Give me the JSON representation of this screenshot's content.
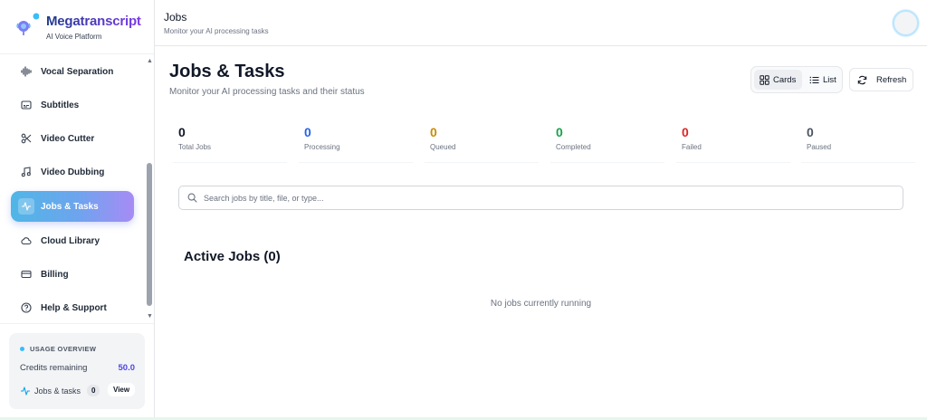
{
  "brand": {
    "name": "Megatranscript",
    "subtitle": "AI Voice Platform"
  },
  "sidebar": {
    "items": [
      {
        "label": "Vocal Separation",
        "icon": "waveform-icon",
        "active": false
      },
      {
        "label": "Subtitles",
        "icon": "subtitles-icon",
        "active": false
      },
      {
        "label": "Video Cutter",
        "icon": "scissors-icon",
        "active": false
      },
      {
        "label": "Video Dubbing",
        "icon": "music-note-icon",
        "active": false
      },
      {
        "label": "Jobs & Tasks",
        "icon": "activity-icon",
        "active": true
      },
      {
        "label": "Cloud Library",
        "icon": "cloud-icon",
        "active": false
      },
      {
        "label": "Billing",
        "icon": "credit-card-icon",
        "active": false
      },
      {
        "label": "Help & Support",
        "icon": "help-circle-icon",
        "active": false
      }
    ],
    "usage": {
      "title": "USAGE OVERVIEW",
      "credits_label": "Credits remaining",
      "credits_value": "50.0",
      "jobs_label": "Jobs & tasks",
      "jobs_count": "0",
      "view_label": "View"
    }
  },
  "header": {
    "title": "Jobs",
    "subtitle": "Monitor your AI processing tasks"
  },
  "main": {
    "title": "Jobs & Tasks",
    "subtitle": "Monitor your AI processing tasks and their status",
    "view_toggle": {
      "cards_label": "Cards",
      "list_label": "List",
      "selected": "Cards"
    },
    "refresh_label": "Refresh",
    "stats": [
      {
        "value": "0",
        "label": "Total Jobs",
        "color": "#111827"
      },
      {
        "value": "0",
        "label": "Processing",
        "color": "#2563eb"
      },
      {
        "value": "0",
        "label": "Queued",
        "color": "#ca8a04"
      },
      {
        "value": "0",
        "label": "Completed",
        "color": "#16a34a"
      },
      {
        "value": "0",
        "label": "Failed",
        "color": "#dc2626"
      },
      {
        "value": "0",
        "label": "Paused",
        "color": "#4b5563"
      }
    ],
    "search": {
      "placeholder": "Search jobs by title, file, or type...",
      "value": ""
    },
    "active_jobs_title": "Active Jobs (0)",
    "empty_message": "No jobs currently running"
  },
  "colors": {
    "accent_start": "#4fb6e6",
    "accent_end": "#a78bf5",
    "credits": "#4f46e5"
  }
}
